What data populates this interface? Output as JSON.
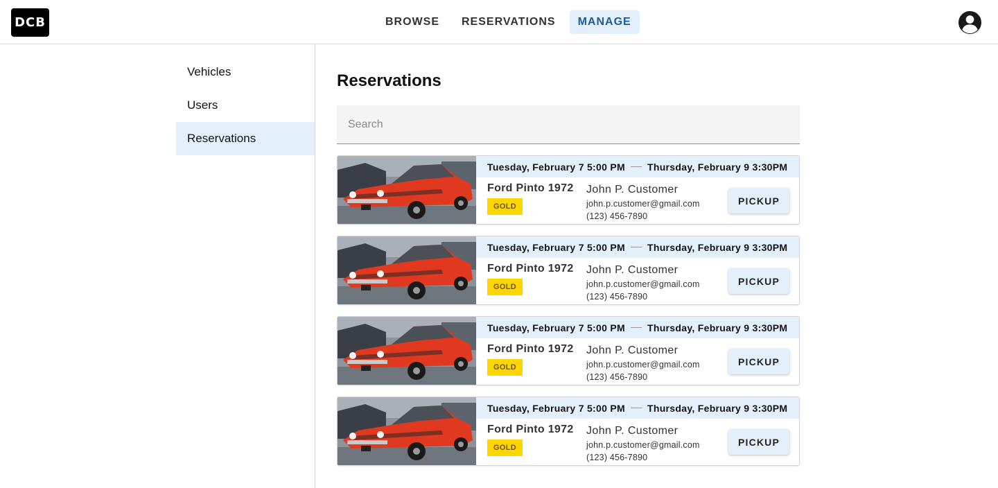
{
  "logo": {
    "text": "DCB"
  },
  "nav": {
    "tabs": [
      {
        "label": "BROWSE",
        "active": false
      },
      {
        "label": "RESERVATIONS",
        "active": false
      },
      {
        "label": "MANAGE",
        "active": true
      }
    ]
  },
  "account": {
    "icon": "account-circle-icon"
  },
  "sidebar": {
    "items": [
      {
        "label": "Vehicles",
        "active": false
      },
      {
        "label": "Users",
        "active": false
      },
      {
        "label": "Reservations",
        "active": true
      }
    ]
  },
  "main": {
    "title": "Reservations",
    "search_placeholder": "Search"
  },
  "reservations": [
    {
      "start": "Tuesday, February 7 5:00 PM",
      "end": "Thursday, February 9 3:30PM",
      "vehicle": "Ford Pinto 1972",
      "tier": "GOLD",
      "customer": "John P. Customer",
      "email": "john.p.customer@gmail.com",
      "phone": "(123) 456-7890",
      "action": "PICKUP"
    },
    {
      "start": "Tuesday, February 7 5:00 PM",
      "end": "Thursday, February 9 3:30PM",
      "vehicle": "Ford Pinto 1972",
      "tier": "GOLD",
      "customer": "John P. Customer",
      "email": "john.p.customer@gmail.com",
      "phone": "(123) 456-7890",
      "action": "PICKUP"
    },
    {
      "start": "Tuesday, February 7 5:00 PM",
      "end": "Thursday, February 9 3:30PM",
      "vehicle": "Ford Pinto 1972",
      "tier": "GOLD",
      "customer": "John P. Customer",
      "email": "john.p.customer@gmail.com",
      "phone": "(123) 456-7890",
      "action": "PICKUP"
    },
    {
      "start": "Tuesday, February 7 5:00 PM",
      "end": "Thursday, February 9 3:30PM",
      "vehicle": "Ford Pinto 1972",
      "tier": "GOLD",
      "customer": "John P. Customer",
      "email": "john.p.customer@gmail.com",
      "phone": "(123) 456-7890",
      "action": "PICKUP"
    }
  ],
  "colors": {
    "accent_bg": "#e3f0fb",
    "accent_text": "#1d5a9e",
    "tier_gold": "#ffd500",
    "car_body": "#e1391f"
  }
}
